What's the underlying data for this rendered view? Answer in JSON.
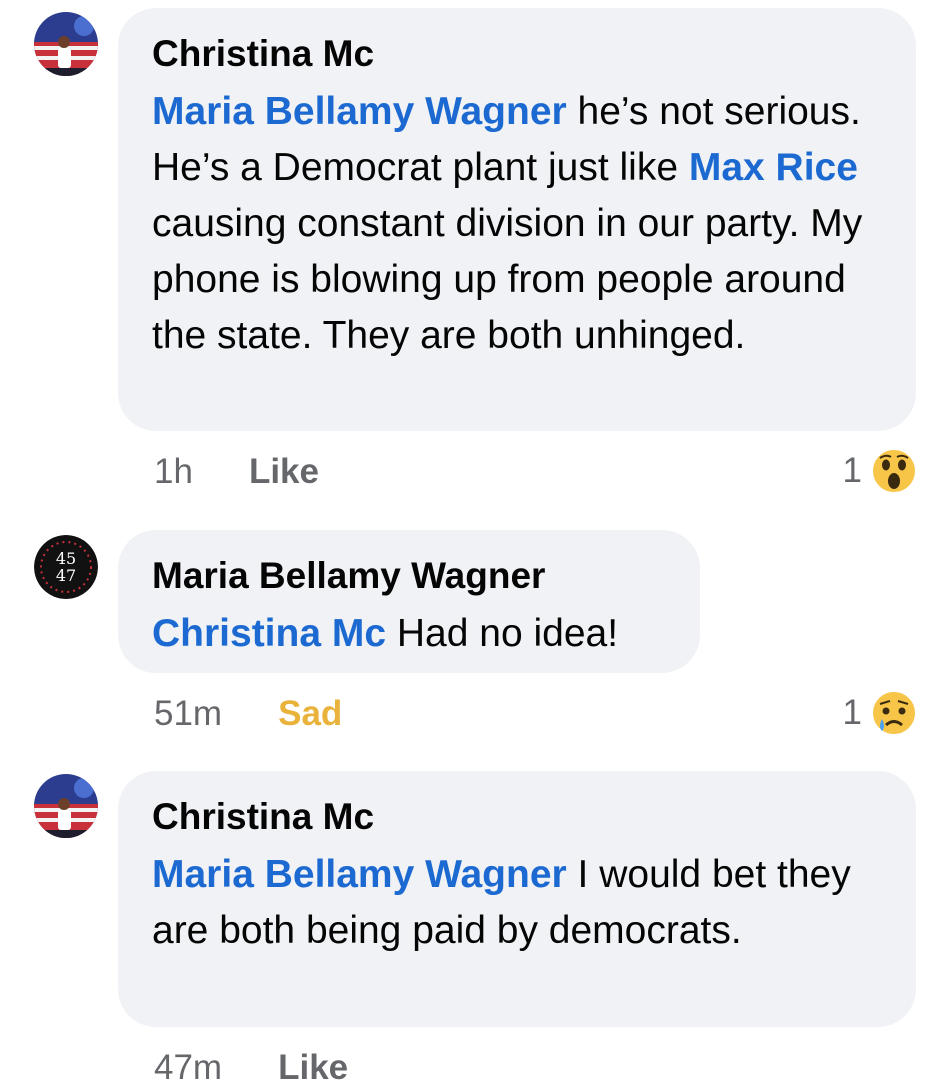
{
  "comments": [
    {
      "author": "Christina Mc",
      "mention": "Maria Bellamy Wagner",
      "text_a": " he’s not serious. He’s a Democrat plant just like ",
      "mention2": "Max Rice",
      "text_b": " causing constant division in our party. My phone is blowing up from people around the state. They are both unhinged.",
      "time": "1h",
      "action": "Like",
      "reaction_count": "1",
      "reaction_icon": "wow-reaction-icon"
    },
    {
      "author": "Maria Bellamy Wagner",
      "avatar_text_top": "45",
      "avatar_text_bottom": "47",
      "mention": "Christina Mc",
      "text": " Had no idea!",
      "time": "51m",
      "action": "Sad",
      "reaction_count": "1",
      "reaction_icon": "sad-reaction-icon"
    },
    {
      "author": "Christina Mc",
      "mention": "Maria Bellamy Wagner",
      "text": " I would bet they are both being paid by democrats.",
      "time": "47m",
      "action": "Like"
    }
  ],
  "colors": {
    "mention": "#1c6ad1",
    "bubble": "#f0f2f5",
    "meta": "#65676b",
    "sad": "#e9b23a"
  }
}
